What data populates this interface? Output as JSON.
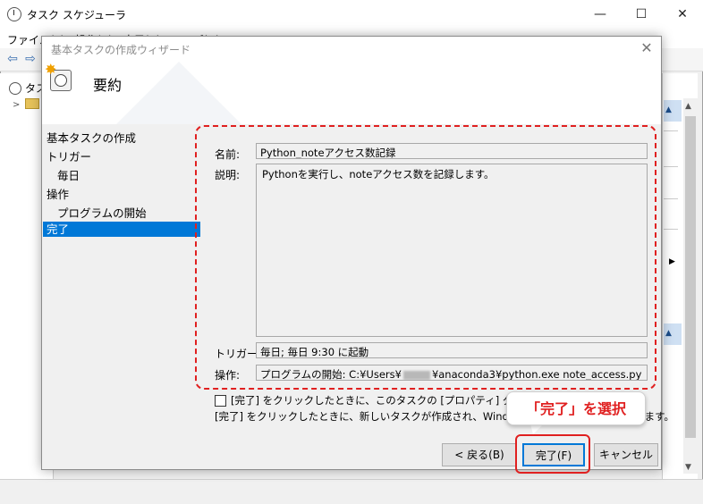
{
  "background_window": {
    "title": "タスク スケジューラ",
    "menu": "ファイル(F)　操作(A)　表示(V)　ヘルプ(H)",
    "tree_root": "タスク",
    "controls": {
      "minimize": "—",
      "maximize": "☐",
      "close": "✕"
    }
  },
  "wizard": {
    "title": "基本タスクの作成ウィザード",
    "header_title": "要約",
    "close": "✕",
    "nav": [
      {
        "label": "基本タスクの作成"
      },
      {
        "label": "トリガー"
      },
      {
        "label": "毎日"
      },
      {
        "label": "操作"
      },
      {
        "label": "プログラムの開始"
      },
      {
        "label": "完了"
      }
    ],
    "fields": {
      "name_label": "名前:",
      "name_value": "Python_noteアクセス数記録",
      "desc_label": "説明:",
      "desc_value": "Pythonを実行し、noteアクセス数を記録します。",
      "trigger_label": "トリガー:",
      "trigger_value": "毎日; 毎日 9:30 に起動",
      "action_label": "操作:",
      "action_prefix": "プログラムの開始: C:¥Users¥",
      "action_suffix": "¥anaconda3¥python.exe note_access.py"
    },
    "checkbox_label": "[完了] をクリックしたときに、このタスクの [プロパティ] ダイアログを開く",
    "info_text": "[完了] をクリックしたときに、新しいタスクが作成され、Windows スケジュールに追加されます。",
    "buttons": {
      "back": "< 戻る(B)",
      "finish": "完了(F)",
      "cancel": "キャンセル"
    }
  },
  "annotation": {
    "callout": "「完了」を選択",
    "color": "#e02020"
  }
}
